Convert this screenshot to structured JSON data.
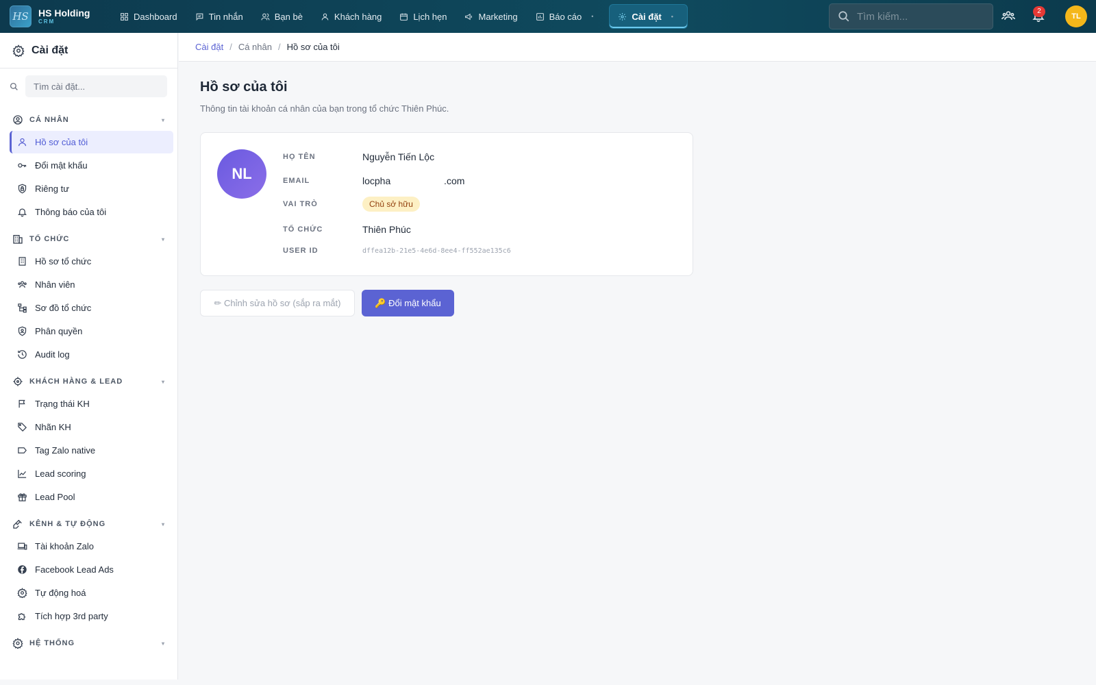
{
  "brand": {
    "logo": "HS",
    "name": "HS Holding",
    "sub": "CRM"
  },
  "nav": [
    {
      "label": "Dashboard",
      "icon": "dashboard-icon"
    },
    {
      "label": "Tin nhắn",
      "icon": "message-icon"
    },
    {
      "label": "Bạn bè",
      "icon": "friends-icon"
    },
    {
      "label": "Khách hàng",
      "icon": "customer-icon"
    },
    {
      "label": "Lịch hẹn",
      "icon": "calendar-icon"
    },
    {
      "label": "Marketing",
      "icon": "megaphone-icon"
    },
    {
      "label": "Báo cáo",
      "icon": "report-icon"
    },
    {
      "label": "Cài đặt",
      "icon": "gear-icon",
      "active": true
    }
  ],
  "top_search": {
    "placeholder": "Tìm kiếm..."
  },
  "notifications": {
    "count": "2"
  },
  "user": {
    "initials": "TL"
  },
  "sidebar": {
    "title": "Cài đặt",
    "search_placeholder": "Tìm cài đặt...",
    "sections": [
      {
        "title": "CÁ NHÂN",
        "items": [
          "Hồ sơ của tôi",
          "Đổi mật khẩu",
          "Riêng tư",
          "Thông báo của tôi"
        ]
      },
      {
        "title": "TỔ CHỨC",
        "items": [
          "Hồ sơ tổ chức",
          "Nhân viên",
          "Sơ đồ tổ chức",
          "Phân quyền",
          "Audit log"
        ]
      },
      {
        "title": "KHÁCH HÀNG & LEAD",
        "items": [
          "Trạng thái KH",
          "Nhãn KH",
          "Tag Zalo native",
          "Lead scoring",
          "Lead Pool"
        ]
      },
      {
        "title": "KÊNH & TỰ ĐỘNG",
        "items": [
          "Tài khoản Zalo",
          "Facebook Lead Ads",
          "Tự động hoá",
          "Tích hợp 3rd party"
        ]
      },
      {
        "title": "HỆ THỐNG",
        "items": []
      }
    ]
  },
  "breadcrumb": [
    "Cài đặt",
    "Cá nhân",
    "Hồ sơ của tôi"
  ],
  "page": {
    "title": "Hồ sơ của tôi",
    "subtitle": "Thông tin tài khoản cá nhân của bạn trong tổ chức Thiên Phúc."
  },
  "profile": {
    "initials": "NL",
    "fields": {
      "name_label": "HỌ TÊN",
      "name": "Nguyễn Tiến Lộc",
      "email_label": "EMAIL",
      "email": "locpha                    .com",
      "role_label": "VAI TRÒ",
      "role": "Chủ sở hữu",
      "org_label": "TỔ CHỨC",
      "org": "Thiên Phúc",
      "uid_label": "USER ID",
      "uid": "dffea12b-21e5-4e6d-8ee4-ff552ae135c6"
    }
  },
  "actions": {
    "edit": "✏ Chỉnh sửa hồ sơ (sắp ra mắt)",
    "change_password": "🔑 Đổi mật khẩu"
  },
  "colors": {
    "accent": "#5b63d3",
    "topbar": "#0d3a4e",
    "notification": "#e53935",
    "avatar": "#f5b71a"
  }
}
